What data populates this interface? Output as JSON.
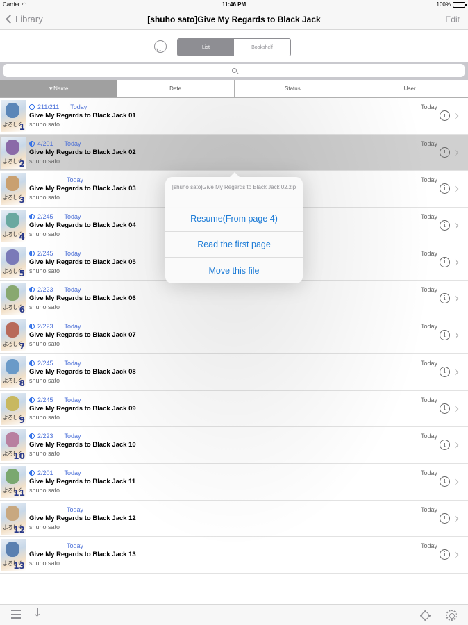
{
  "status": {
    "carrier": "Carrier",
    "time": "11:46 PM",
    "battery": "100%"
  },
  "nav": {
    "back_label": "Library",
    "title": "[shuho sato]Give My Regards to Black Jack",
    "edit_label": "Edit"
  },
  "segment": {
    "list_label": "List",
    "bookshelf_label": "Bookshelf"
  },
  "sort": {
    "name": "▼Name",
    "date": "Date",
    "status": "Status",
    "user": "User"
  },
  "rows": [
    {
      "progress": "211/211",
      "time": "Today",
      "title": "Give My Regards to Black Jack 01",
      "author": "shuho sato",
      "date": "Today",
      "num": "1"
    },
    {
      "progress": "4/201",
      "time": "Today",
      "title": "Give My Regards to Black Jack 02",
      "author": "shuho sato",
      "date": "Today",
      "num": "2"
    },
    {
      "progress": "",
      "time": "Today",
      "title": "Give My Regards to Black Jack 03",
      "author": "shuho sato",
      "date": "Today",
      "num": "3"
    },
    {
      "progress": "2/245",
      "time": "Today",
      "title": "Give My Regards to Black Jack 04",
      "author": "shuho sato",
      "date": "Today",
      "num": "4"
    },
    {
      "progress": "2/245",
      "time": "Today",
      "title": "Give My Regards to Black Jack 05",
      "author": "shuho sato",
      "date": "Today",
      "num": "5"
    },
    {
      "progress": "2/223",
      "time": "Today",
      "title": "Give My Regards to Black Jack 06",
      "author": "shuho sato",
      "date": "Today",
      "num": "6"
    },
    {
      "progress": "2/223",
      "time": "Today",
      "title": "Give My Regards to Black Jack 07",
      "author": "shuho sato",
      "date": "Today",
      "num": "7"
    },
    {
      "progress": "2/245",
      "time": "Today",
      "title": "Give My Regards to Black Jack 08",
      "author": "shuho sato",
      "date": "Today",
      "num": "8"
    },
    {
      "progress": "2/245",
      "time": "Today",
      "title": "Give My Regards to Black Jack 09",
      "author": "shuho sato",
      "date": "Today",
      "num": "9"
    },
    {
      "progress": "2/223",
      "time": "Today",
      "title": "Give My Regards to Black Jack 10",
      "author": "shuho sato",
      "date": "Today",
      "num": "10"
    },
    {
      "progress": "2/201",
      "time": "Today",
      "title": "Give My Regards to Black Jack 11",
      "author": "shuho sato",
      "date": "Today",
      "num": "11"
    },
    {
      "progress": "",
      "time": "Today",
      "title": "Give My Regards to Black Jack 12",
      "author": "shuho sato",
      "date": "Today",
      "num": "12"
    },
    {
      "progress": "",
      "time": "Today",
      "title": "Give My Regards to Black Jack 13",
      "author": "shuho sato",
      "date": "Today",
      "num": "13"
    }
  ],
  "thumb_text": "よろしく",
  "popover": {
    "title": "[shuho sato]Give My Regards to Black Jack 02.zip",
    "resume": "Resume(From page 4)",
    "first_page": "Read the first page",
    "move": "Move this file"
  },
  "colors": {
    "accent": "#1a7ad6",
    "meta_blue": "#4a6fd8",
    "selected_row": "#d0d0d0"
  },
  "icons": {
    "back": "chevron-left-icon",
    "refresh": "refresh-icon",
    "search": "search-icon",
    "info": "info-icon",
    "menu": "list-icon",
    "download": "download-icon",
    "brightness": "brightness-icon",
    "settings": "gear-icon"
  }
}
